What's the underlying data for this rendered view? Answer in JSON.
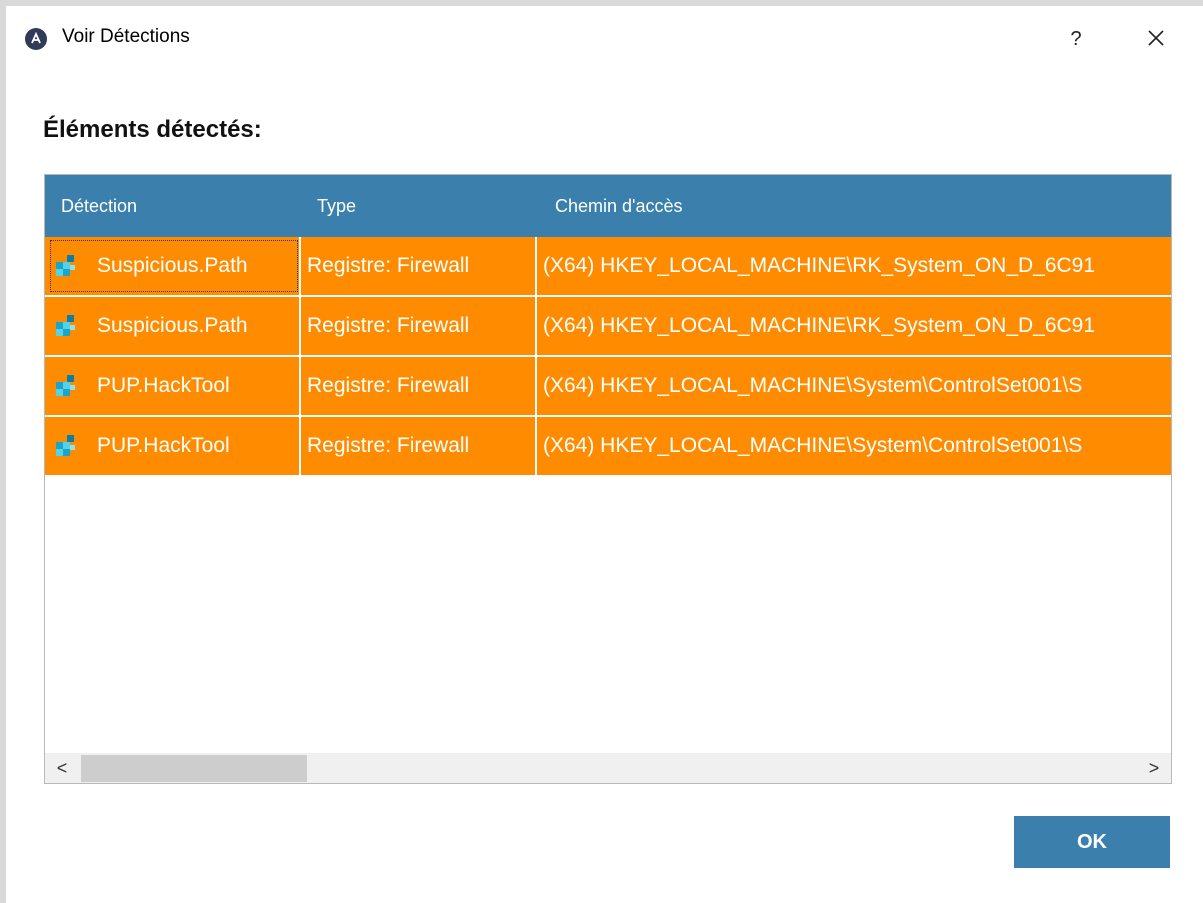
{
  "window": {
    "title": "Voir Détections",
    "help_label": "?"
  },
  "heading": "Éléments détectés:",
  "table": {
    "columns": [
      "Détection",
      "Type",
      "Chemin d'accès"
    ],
    "rows": [
      {
        "detection": "Suspicious.Path",
        "type": "Registre: Firewall",
        "path": "(X64) HKEY_LOCAL_MACHINE\\RK_System_ON_D_6C91"
      },
      {
        "detection": "Suspicious.Path",
        "type": "Registre: Firewall",
        "path": "(X64) HKEY_LOCAL_MACHINE\\RK_System_ON_D_6C91"
      },
      {
        "detection": "PUP.HackTool",
        "type": "Registre: Firewall",
        "path": "(X64) HKEY_LOCAL_MACHINE\\System\\ControlSet001\\S"
      },
      {
        "detection": "PUP.HackTool",
        "type": "Registre: Firewall",
        "path": "(X64) HKEY_LOCAL_MACHINE\\System\\ControlSet001\\S"
      }
    ],
    "row_icon": "registry-icon"
  },
  "scrollbar": {
    "left_arrow": "<",
    "right_arrow": ">"
  },
  "ok_button": "OK",
  "colors": {
    "header_bg": "#3b80ad",
    "row_bg": "#ff8c00",
    "button_bg": "#3b80ad"
  }
}
